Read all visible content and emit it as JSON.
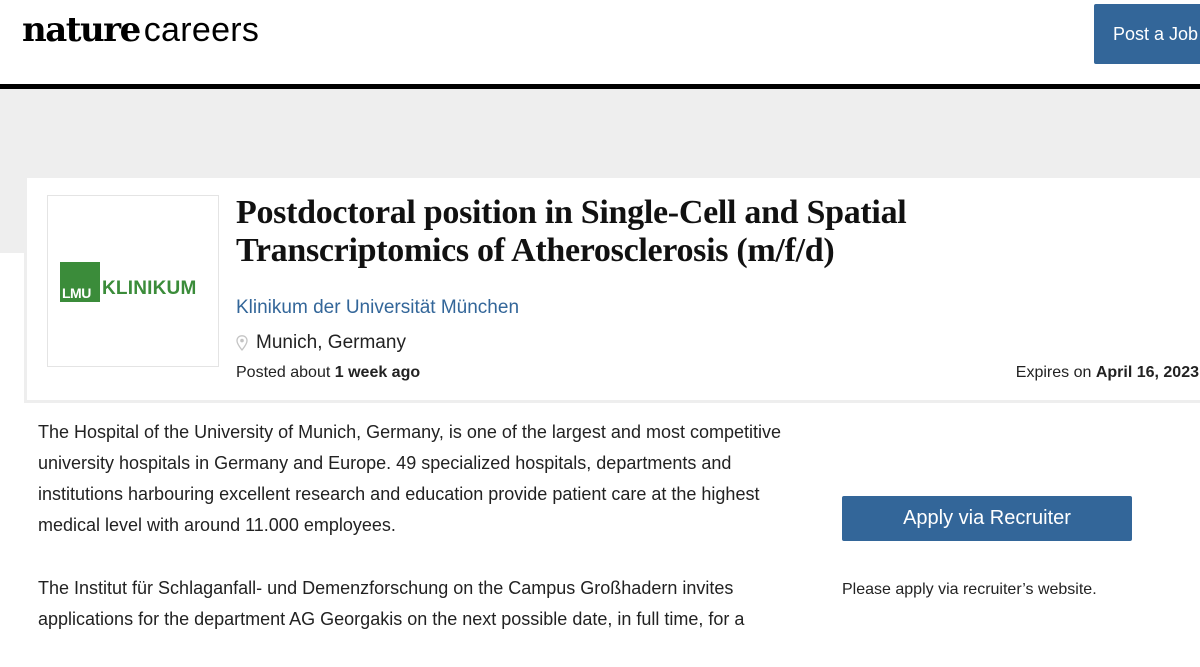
{
  "header": {
    "logo_primary": "nature",
    "logo_secondary": "careers",
    "post_job_label": "Post a Job"
  },
  "job": {
    "title": "Postdoctoral position in Single-Cell and Spatial Transcriptomics of Atherosclerosis (m/f/d)",
    "employer": "Klinikum der Universität München",
    "location": "Munich, Germany",
    "location_icon": "map-pin-icon",
    "posted_prefix": "Posted about ",
    "posted_value": "1 week ago",
    "expires_prefix": "Expires on ",
    "expires_value": "April 16, 2023",
    "employer_logo": {
      "mark_text": "LMU",
      "word": "KLINIKUM",
      "color": "#3b8c3a"
    }
  },
  "description": {
    "paragraphs": [
      "The Hospital of the University of Munich, Germany, is one of the largest and most competitive university hospitals in Germany and Europe. 49 specialized hospitals, departments and institutions harbouring excellent research and education provide patient care at the highest medical level with around 11.000 employees.",
      "The Institut für Schlaganfall- und Demenzforschung on the Campus Großhadern invites applications for the department AG Georgakis on the next possible date, in full time, for a"
    ]
  },
  "sidebar": {
    "apply_label": "Apply via Recruiter",
    "apply_note": "Please apply via recruiter’s website."
  },
  "colors": {
    "accent": "#336699",
    "header_rule": "#000000",
    "band": "#eeeeee"
  }
}
